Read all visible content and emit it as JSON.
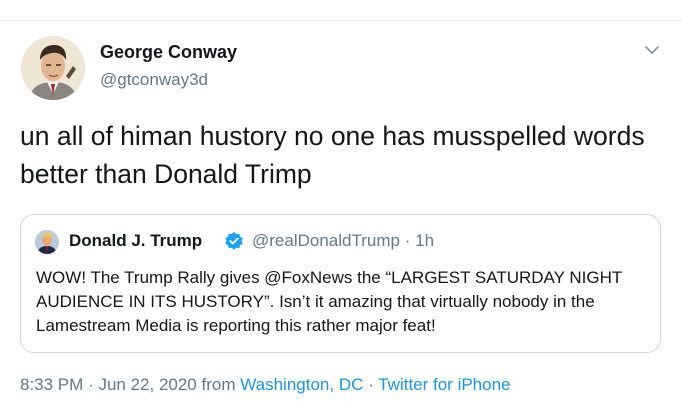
{
  "author": {
    "name": "George Conway",
    "handle": "@gtconway3d"
  },
  "tweet": {
    "text": "un all of himan hustory no one has musspelled words better than Donald Trimp"
  },
  "quoted_tweet": {
    "name": "Donald J. Trump",
    "handle": "@realDonaldTrump",
    "separator": "·",
    "time": "1h",
    "text": "WOW! The Trump Rally gives @FoxNews the “LARGEST SATURDAY NIGHT AUDIENCE IN ITS HUSTORY”. Isn’t it amazing that virtually nobody in the Lamestream Media is reporting this rather major feat!"
  },
  "footer": {
    "time": "8:33 PM",
    "sep1": "·",
    "date": "Jun 22, 2020",
    "from_word": "from",
    "location": "Washington, DC",
    "sep2": "·",
    "source": "Twitter for iPhone"
  },
  "icons": {
    "caret": "chevron-down-icon",
    "verified": "verified-badge-icon"
  },
  "colors": {
    "link": "#1b95e0",
    "secondary_text": "#657786",
    "primary_text": "#14171a",
    "border": "#ccd6dd",
    "verified": "#1da1f2"
  }
}
